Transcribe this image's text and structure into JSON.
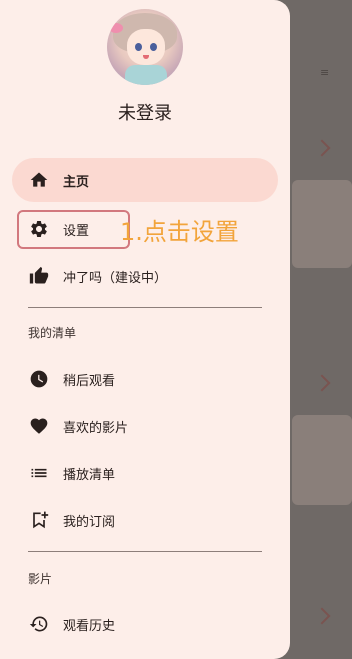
{
  "user": {
    "name": "未登录"
  },
  "nav": {
    "home": "主页",
    "settings": "设置",
    "chongle": "冲了吗（建设中）"
  },
  "sections": {
    "my_list": {
      "title": "我的清单",
      "items": [
        "稍后观看",
        "喜欢的影片",
        "播放清单",
        "我的订阅"
      ]
    },
    "films": {
      "title": "影片",
      "items": [
        "观看历史"
      ]
    }
  },
  "annotation": {
    "text": "1.点击设置"
  },
  "colors": {
    "drawer_bg": "#fdeee9",
    "active_bg": "#fbd9d1",
    "annotation": "#f2a43b",
    "highlight_border": "#d2787e",
    "scrim": "#6f6966"
  }
}
